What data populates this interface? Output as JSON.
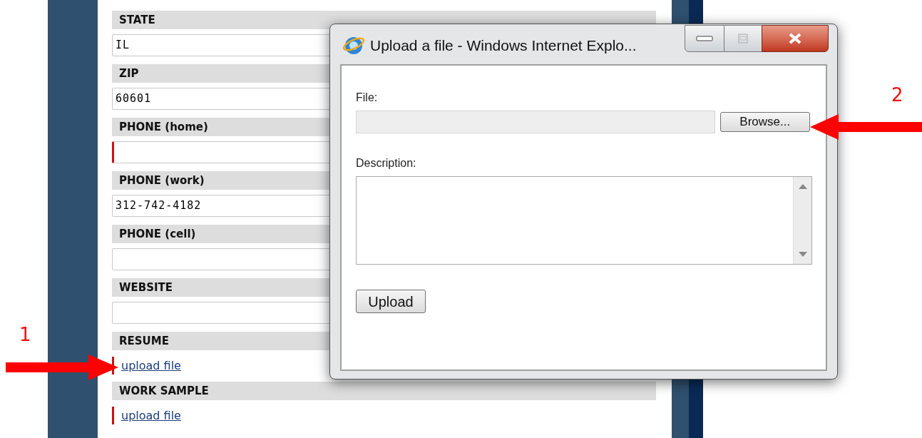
{
  "form": {
    "fields": [
      {
        "label": "STATE",
        "kind": "text",
        "value": "IL",
        "required": false
      },
      {
        "label": "ZIP",
        "kind": "text",
        "value": "60601",
        "required": false
      },
      {
        "label": "PHONE (home)",
        "kind": "text",
        "required": true
      },
      {
        "label": "PHONE (work)",
        "kind": "text",
        "value": "312-742-4182",
        "required": false
      },
      {
        "label": "PHONE (cell)",
        "kind": "text",
        "required": false
      },
      {
        "label": "WEBSITE",
        "kind": "text",
        "required": false
      },
      {
        "label": "RESUME",
        "kind": "upload",
        "link": "upload file",
        "required": true
      },
      {
        "label": "WORK SAMPLE",
        "kind": "upload",
        "link": "upload file",
        "required": true
      }
    ]
  },
  "dialog": {
    "title": "Upload a file - Windows Internet Explo...",
    "file_label": "File:",
    "browse_button": "Browse...",
    "description_label": "Description:",
    "upload_button": "Upload"
  },
  "annotations": [
    {
      "number": "1",
      "kind": "rightward"
    },
    {
      "number": "2",
      "kind": "leftward"
    }
  ]
}
